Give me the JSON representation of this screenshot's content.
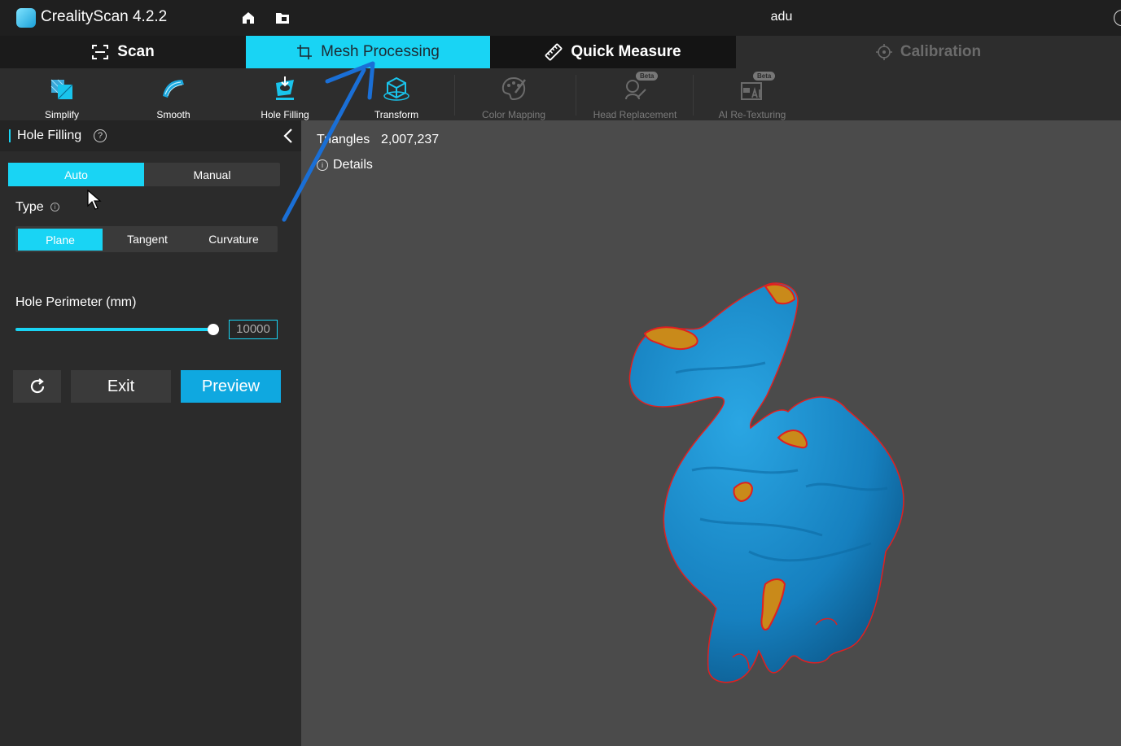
{
  "app": {
    "title": "CrealityScan 4.2.2",
    "project_name": "adu"
  },
  "tabs": [
    {
      "label": "Scan",
      "active": false
    },
    {
      "label": "Mesh Processing",
      "active": true
    },
    {
      "label": "Quick Measure",
      "active": false
    },
    {
      "label": "Calibration",
      "active": false,
      "disabled": true
    }
  ],
  "toolbar": {
    "tools": [
      {
        "label": "Simplify",
        "icon": "simplify-icon"
      },
      {
        "label": "Smooth",
        "icon": "smooth-icon"
      },
      {
        "label": "Hole Filling",
        "icon": "hole-filling-icon",
        "active": true
      },
      {
        "label": "Transform",
        "icon": "transform-icon"
      },
      {
        "label": "Color Mapping",
        "icon": "color-mapping-icon",
        "disabled": true
      },
      {
        "label": "Head Replacement",
        "icon": "head-replacement-icon",
        "disabled": true,
        "badge": "Beta"
      },
      {
        "label": "AI Re-Texturing",
        "icon": "ai-retexturing-icon",
        "disabled": true,
        "badge": "Beta"
      }
    ]
  },
  "panel": {
    "title": "Hole Filling",
    "modes": [
      "Auto",
      "Manual"
    ],
    "selected_mode": "Auto",
    "type_label": "Type",
    "types": [
      "Plane",
      "Tangent",
      "Curvature"
    ],
    "selected_type": "Plane",
    "perimeter_label": "Hole Perimeter (mm)",
    "perimeter_value": "10000",
    "perimeter_slider_fraction": 1.0,
    "exit_label": "Exit",
    "preview_label": "Preview"
  },
  "viewport": {
    "triangles_label": "Triangles",
    "triangles_value": "2,007,237",
    "details_label": "Details"
  },
  "colors": {
    "accent": "#19d4f4",
    "primary_button": "#0fa8e0",
    "model": "#1e8bc8",
    "hole_fill": "#c98a1a",
    "hole_edge": "#e02020"
  }
}
